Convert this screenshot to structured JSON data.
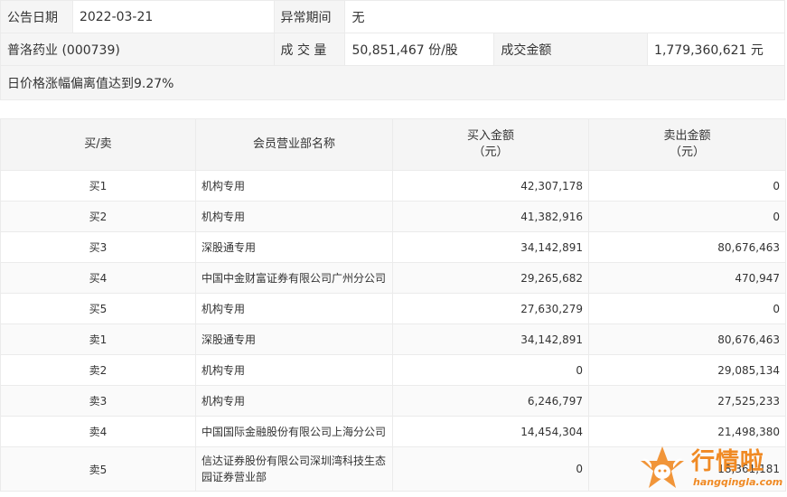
{
  "info": {
    "announce_label": "公告日期",
    "announce_value": "2022-03-21",
    "abnormal_label": "异常期间",
    "abnormal_value": "无",
    "stock_name": "普洛药业 (000739)",
    "volume_label": "成 交 量",
    "volume_value": "50,851,467 份/股",
    "amount_label": "成交金额",
    "amount_value": "1,779,360,621 元",
    "reason": "日价格涨幅偏离值达到9.27%"
  },
  "table": {
    "headers": {
      "side": "买/卖",
      "broker": "会员营业部名称",
      "buy_line1": "买入金额",
      "buy_line2": "（元）",
      "sell_line1": "卖出金额",
      "sell_line2": "（元）"
    },
    "rows": [
      {
        "side": "买1",
        "broker": "机构专用",
        "buy": "42,307,178",
        "sell": "0"
      },
      {
        "side": "买2",
        "broker": "机构专用",
        "buy": "41,382,916",
        "sell": "0"
      },
      {
        "side": "买3",
        "broker": "深股通专用",
        "buy": "34,142,891",
        "sell": "80,676,463"
      },
      {
        "side": "买4",
        "broker": "中国中金财富证券有限公司广州分公司",
        "buy": "29,265,682",
        "sell": "470,947"
      },
      {
        "side": "买5",
        "broker": "机构专用",
        "buy": "27,630,279",
        "sell": "0"
      },
      {
        "side": "卖1",
        "broker": "深股通专用",
        "buy": "34,142,891",
        "sell": "80,676,463"
      },
      {
        "side": "卖2",
        "broker": "机构专用",
        "buy": "0",
        "sell": "29,085,134"
      },
      {
        "side": "卖3",
        "broker": "机构专用",
        "buy": "6,246,797",
        "sell": "27,525,233"
      },
      {
        "side": "卖4",
        "broker": "中国国际金融股份有限公司上海分公司",
        "buy": "14,454,304",
        "sell": "21,498,380"
      },
      {
        "side": "卖5",
        "broker": "信达证券股份有限公司深圳湾科技生态园证券营业部",
        "buy": "0",
        "sell": "18,361,181"
      }
    ]
  },
  "watermark": {
    "brand": "行情啦",
    "url": "hangqingla.com",
    "color": "#f08a24"
  }
}
